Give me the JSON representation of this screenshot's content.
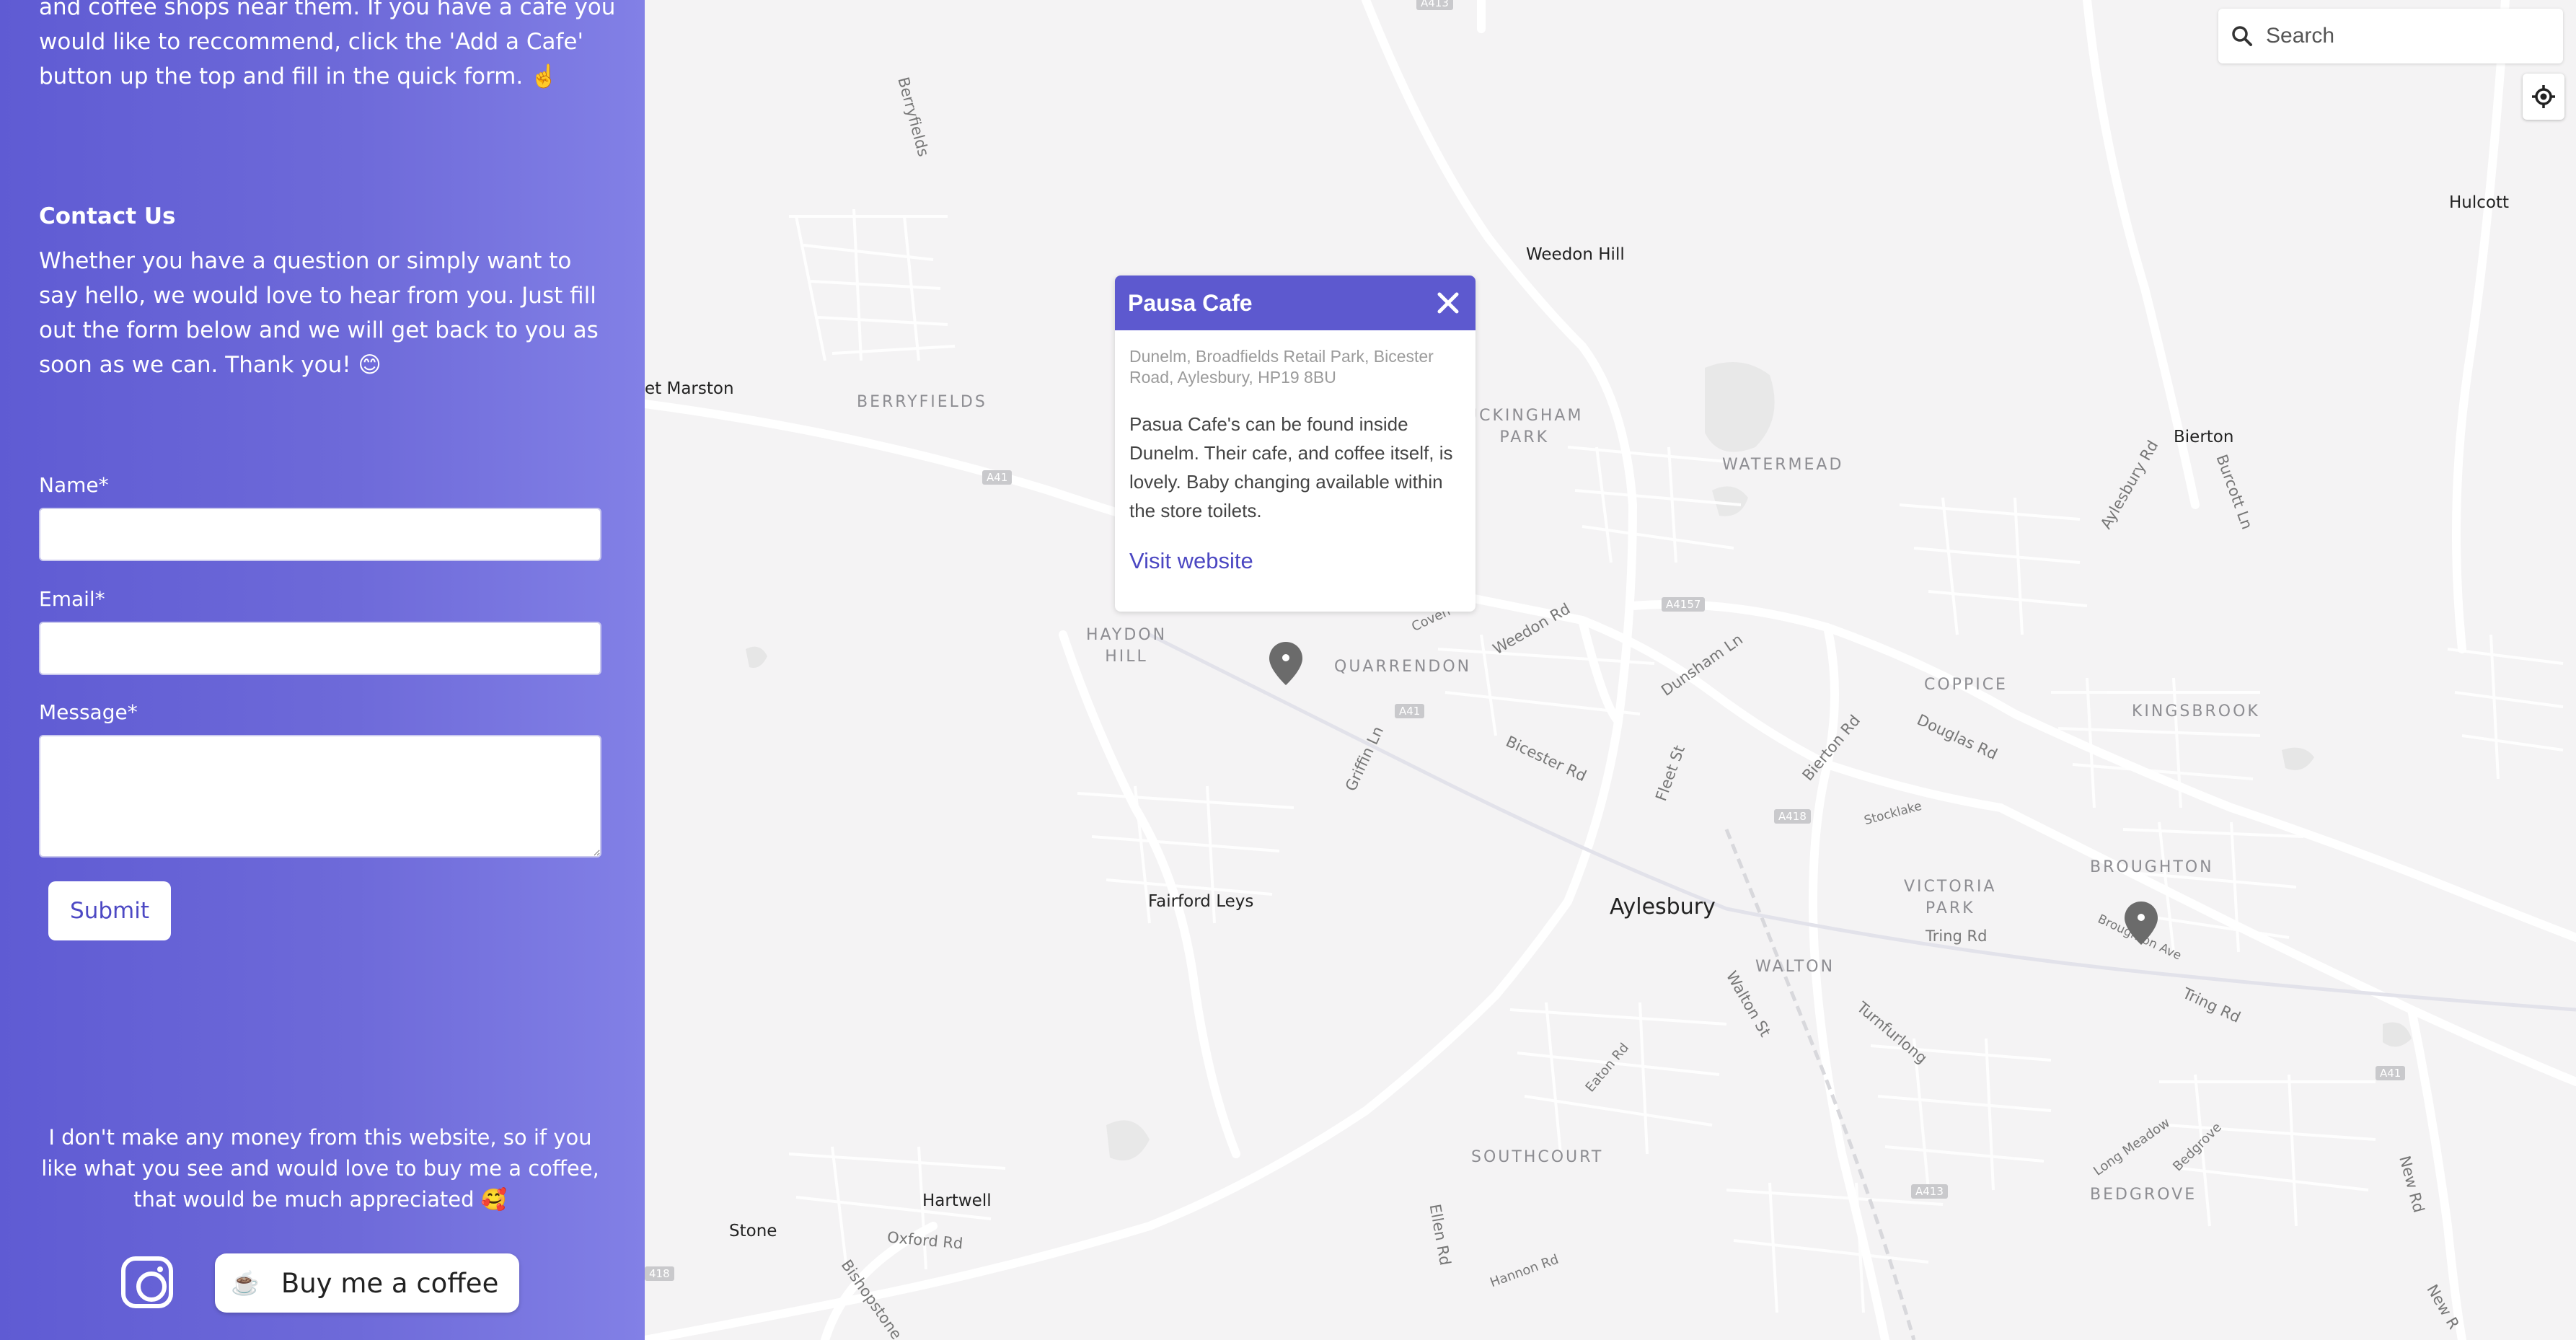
{
  "sidebar": {
    "intro_text": "and coffee shops near them. If you have a cafe you would like to reccommend, click the 'Add a Cafe' button up the top and fill in the quick form. ☝️",
    "contact_heading": "Contact Us",
    "contact_text": "Whether you have a question or simply want to say hello, we would love to hear from you. Just fill out the form below and we will get back to you as soon as we can. Thank you! 😊",
    "form": {
      "name_label": "Name*",
      "name_value": "",
      "email_label": "Email*",
      "email_value": "",
      "message_label": "Message*",
      "message_value": "",
      "submit_label": "Submit"
    },
    "donate_text": "I don't make any money from this website, so if you like what you see and would love to buy me a coffee, that would be much appreciated 🥰",
    "coffee_button_label": "Buy me a coffee",
    "coffee_button_icon": "☕",
    "instagram_icon": "instagram-icon"
  },
  "map": {
    "search_placeholder": "Search",
    "places": {
      "hulcott": "Hulcott",
      "weedon_hill": "Weedon Hill",
      "bierton": "Bierton",
      "aylesbury": "Aylesbury",
      "fairford_leys": "Fairford Leys",
      "hartwell": "Hartwell",
      "stone": "Stone",
      "marston": "et Marston"
    },
    "areas": {
      "berryfields": "BERRYFIELDS",
      "buckingham_park": "UCKINGHAM\nPARK",
      "watermead": "WATERMEAD",
      "haydon_hill": "HAYDON\nHILL",
      "quarrendon": "QUARRENDON",
      "coppice": "COPPICE",
      "kingsbrook": "KINGSBROOK",
      "broughton": "BROUGHTON",
      "victoria_park": "VICTORIA\nPARK",
      "walton": "WALTON",
      "southcourt": "SOUTHCOURT",
      "bedgrove": "BEDGROVE"
    },
    "roads": {
      "berryfields": "Berryfields",
      "weedon_rd": "Weedon Rd",
      "dunsham_ln": "Dunsham Ln",
      "aylesbury_rd": "Aylesbury Rd",
      "burcott_ln": "Burcott Ln",
      "bicester_rd": "Bicester Rd",
      "griffin_ln": "Griffin Ln",
      "fleet_st": "Fleet St",
      "bierton_rd": "Bierton Rd",
      "douglas_rd": "Douglas Rd",
      "stocklake": "Stocklake",
      "tring_rd": "Tring Rd",
      "tring_rd_2": "Tring Rd",
      "broughton_ave": "Broughton Ave",
      "walton_st": "Walton St",
      "turnfurlong": "Turnfurlong",
      "eaton_rd": "Eaton Rd",
      "long_meadow": "Long Meadow",
      "bedgrove": "Bedgrove",
      "new_rd": "New Rd",
      "new_rd_2": "New R",
      "ellen_rd": "Ellen Rd",
      "hannon_rd": "Hannon Rd",
      "oxford_rd": "Oxford Rd",
      "bishopstone": "Bishopstone",
      "coventon": "Coven"
    },
    "shields": {
      "a41_1": "A41",
      "a41_2": "A41",
      "a41_3": "A41",
      "a4157": "A4157",
      "a418": "A418",
      "a413": "A413",
      "a418_west": "418",
      "a413_top": "A413"
    },
    "popup": {
      "title": "Pausa Cafe",
      "address": "Dunelm, Broadfields Retail Park, Bicester Road, Aylesbury, HP19 8BU",
      "description": "Pasua Cafe's can be found inside Dunelm. Their cafe, and coffee itself, is lovely. Baby changing available within the store toilets.",
      "link_label": "Visit website"
    }
  },
  "colors": {
    "accent": "#5d59cf",
    "sidebar_start": "#5f5bd3",
    "sidebar_end": "#8280e6",
    "map_bg": "#f4f3f4",
    "road": "#ffffff",
    "pin": "#6b6b6b"
  }
}
